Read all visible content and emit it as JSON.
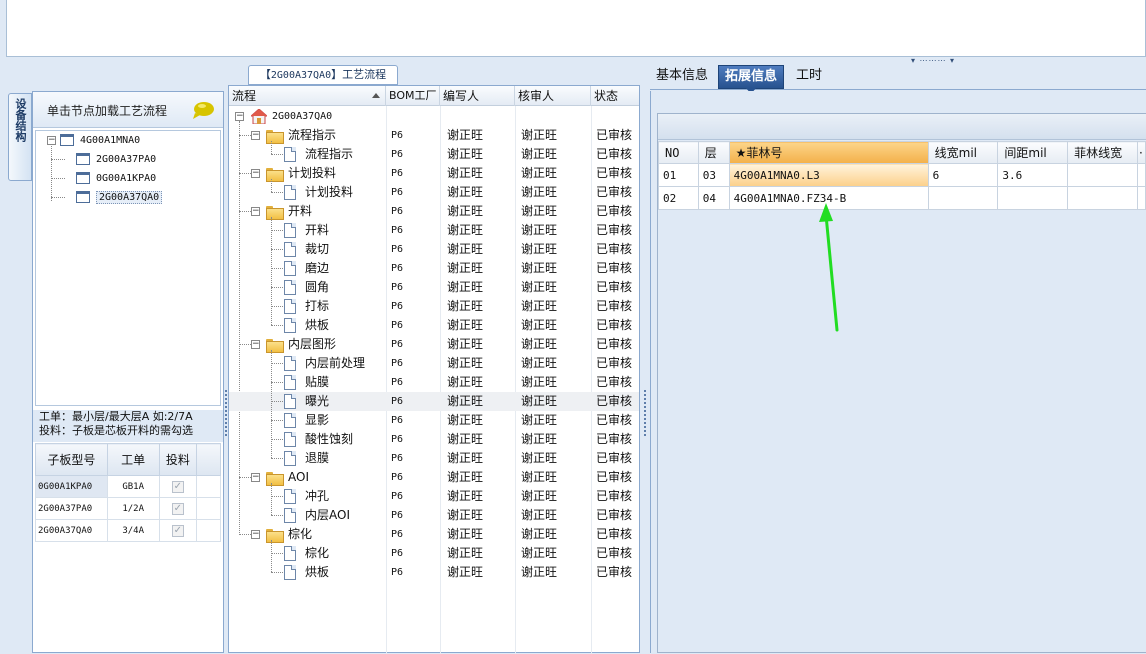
{
  "top": {
    "grip": "▾ ⋯⋯⋯ ▾"
  },
  "left": {
    "vertical_tab": "设备结构",
    "hint": "单击节点加载工艺流程",
    "tree": [
      {
        "label": "4G00A1MNA0",
        "level": 0
      },
      {
        "label": "2G00A37PA0",
        "level": 1
      },
      {
        "label": "0G00A1KPA0",
        "level": 1
      },
      {
        "label": "2G00A37QA0",
        "level": 1
      }
    ],
    "notes": [
      "工单：最小层/最大层A 如:2/7A",
      "投料：子板是芯板开料的需勾选"
    ],
    "table": {
      "headers": [
        "子板型号",
        "工单",
        "投料"
      ],
      "rows": [
        {
          "code": "0G00A1KPA0",
          "order": "GB1A",
          "check": "✓"
        },
        {
          "code": "2G00A37PA0",
          "order": "1/2A",
          "check": "✓"
        },
        {
          "code": "2G00A37QA0",
          "order": "3/4A",
          "check": "✓"
        }
      ]
    }
  },
  "middle": {
    "title_prefix": "【",
    "title_code": "2G00A37QA0",
    "title_suffix": "】工艺流程",
    "headers": {
      "flow": "流程",
      "bom": "BOM工厂",
      "author": "编写人",
      "reviewer": "核审人",
      "status": "状态"
    },
    "root": "2G00A37QA0",
    "rows": [
      {
        "name": "流程指示",
        "type": "folder",
        "bom": "P6",
        "author": "谢正旺",
        "reviewer": "谢正旺",
        "status": "已审核"
      },
      {
        "name": "流程指示",
        "type": "doc",
        "bom": "P6",
        "author": "谢正旺",
        "reviewer": "谢正旺",
        "status": "已审核"
      },
      {
        "name": "计划投料",
        "type": "folder",
        "bom": "P6",
        "author": "谢正旺",
        "reviewer": "谢正旺",
        "status": "已审核"
      },
      {
        "name": "计划投料",
        "type": "doc",
        "bom": "P6",
        "author": "谢正旺",
        "reviewer": "谢正旺",
        "status": "已审核"
      },
      {
        "name": "开料",
        "type": "folder",
        "bom": "P6",
        "author": "谢正旺",
        "reviewer": "谢正旺",
        "status": "已审核"
      },
      {
        "name": "开料",
        "type": "doc",
        "bom": "P6",
        "author": "谢正旺",
        "reviewer": "谢正旺",
        "status": "已审核"
      },
      {
        "name": "裁切",
        "type": "doc",
        "bom": "P6",
        "author": "谢正旺",
        "reviewer": "谢正旺",
        "status": "已审核"
      },
      {
        "name": "磨边",
        "type": "doc",
        "bom": "P6",
        "author": "谢正旺",
        "reviewer": "谢正旺",
        "status": "已审核"
      },
      {
        "name": "圆角",
        "type": "doc",
        "bom": "P6",
        "author": "谢正旺",
        "reviewer": "谢正旺",
        "status": "已审核"
      },
      {
        "name": "打标",
        "type": "doc",
        "bom": "P6",
        "author": "谢正旺",
        "reviewer": "谢正旺",
        "status": "已审核"
      },
      {
        "name": "烘板",
        "type": "doc",
        "bom": "P6",
        "author": "谢正旺",
        "reviewer": "谢正旺",
        "status": "已审核"
      },
      {
        "name": "内层图形",
        "type": "folder",
        "bom": "P6",
        "author": "谢正旺",
        "reviewer": "谢正旺",
        "status": "已审核"
      },
      {
        "name": "内层前处理",
        "type": "doc",
        "bom": "P6",
        "author": "谢正旺",
        "reviewer": "谢正旺",
        "status": "已审核"
      },
      {
        "name": "贴膜",
        "type": "doc",
        "bom": "P6",
        "author": "谢正旺",
        "reviewer": "谢正旺",
        "status": "已审核"
      },
      {
        "name": "曝光",
        "type": "doc",
        "bom": "P6",
        "author": "谢正旺",
        "reviewer": "谢正旺",
        "status": "已审核"
      },
      {
        "name": "显影",
        "type": "doc",
        "bom": "P6",
        "author": "谢正旺",
        "reviewer": "谢正旺",
        "status": "已审核"
      },
      {
        "name": "酸性蚀刻",
        "type": "doc",
        "bom": "P6",
        "author": "谢正旺",
        "reviewer": "谢正旺",
        "status": "已审核"
      },
      {
        "name": "退膜",
        "type": "doc",
        "bom": "P6",
        "author": "谢正旺",
        "reviewer": "谢正旺",
        "status": "已审核"
      },
      {
        "name": "AOI",
        "type": "folder",
        "bom": "P6",
        "author": "谢正旺",
        "reviewer": "谢正旺",
        "status": "已审核"
      },
      {
        "name": "冲孔",
        "type": "doc",
        "bom": "P6",
        "author": "谢正旺",
        "reviewer": "谢正旺",
        "status": "已审核"
      },
      {
        "name": "内层AOI",
        "type": "doc",
        "bom": "P6",
        "author": "谢正旺",
        "reviewer": "谢正旺",
        "status": "已审核"
      },
      {
        "name": "棕化",
        "type": "folder",
        "bom": "P6",
        "author": "谢正旺",
        "reviewer": "谢正旺",
        "status": "已审核"
      },
      {
        "name": "棕化",
        "type": "doc",
        "bom": "P6",
        "author": "谢正旺",
        "reviewer": "谢正旺",
        "status": "已审核"
      },
      {
        "name": "烘板",
        "type": "doc",
        "bom": "P6",
        "author": "谢正旺",
        "reviewer": "谢正旺",
        "status": "已审核"
      }
    ]
  },
  "right": {
    "tabs": [
      "基本信息",
      "拓展信息",
      "工时"
    ],
    "active_tab": "拓展信息",
    "grid": {
      "headers": [
        "NO",
        "层",
        "★菲林号",
        "线宽mil",
        "间距mil",
        "菲林线宽",
        "·"
      ],
      "rows": [
        {
          "no": "01",
          "layer": "03",
          "film": "4G00A1MNA0.L3",
          "width": "6",
          "spacing": "3.6",
          "film_width": ""
        },
        {
          "no": "02",
          "layer": "04",
          "film": "4G00A1MNA0.FZ34-B",
          "width": "",
          "spacing": "",
          "film_width": ""
        }
      ]
    }
  },
  "annotation": {
    "color": "#22dd22"
  }
}
